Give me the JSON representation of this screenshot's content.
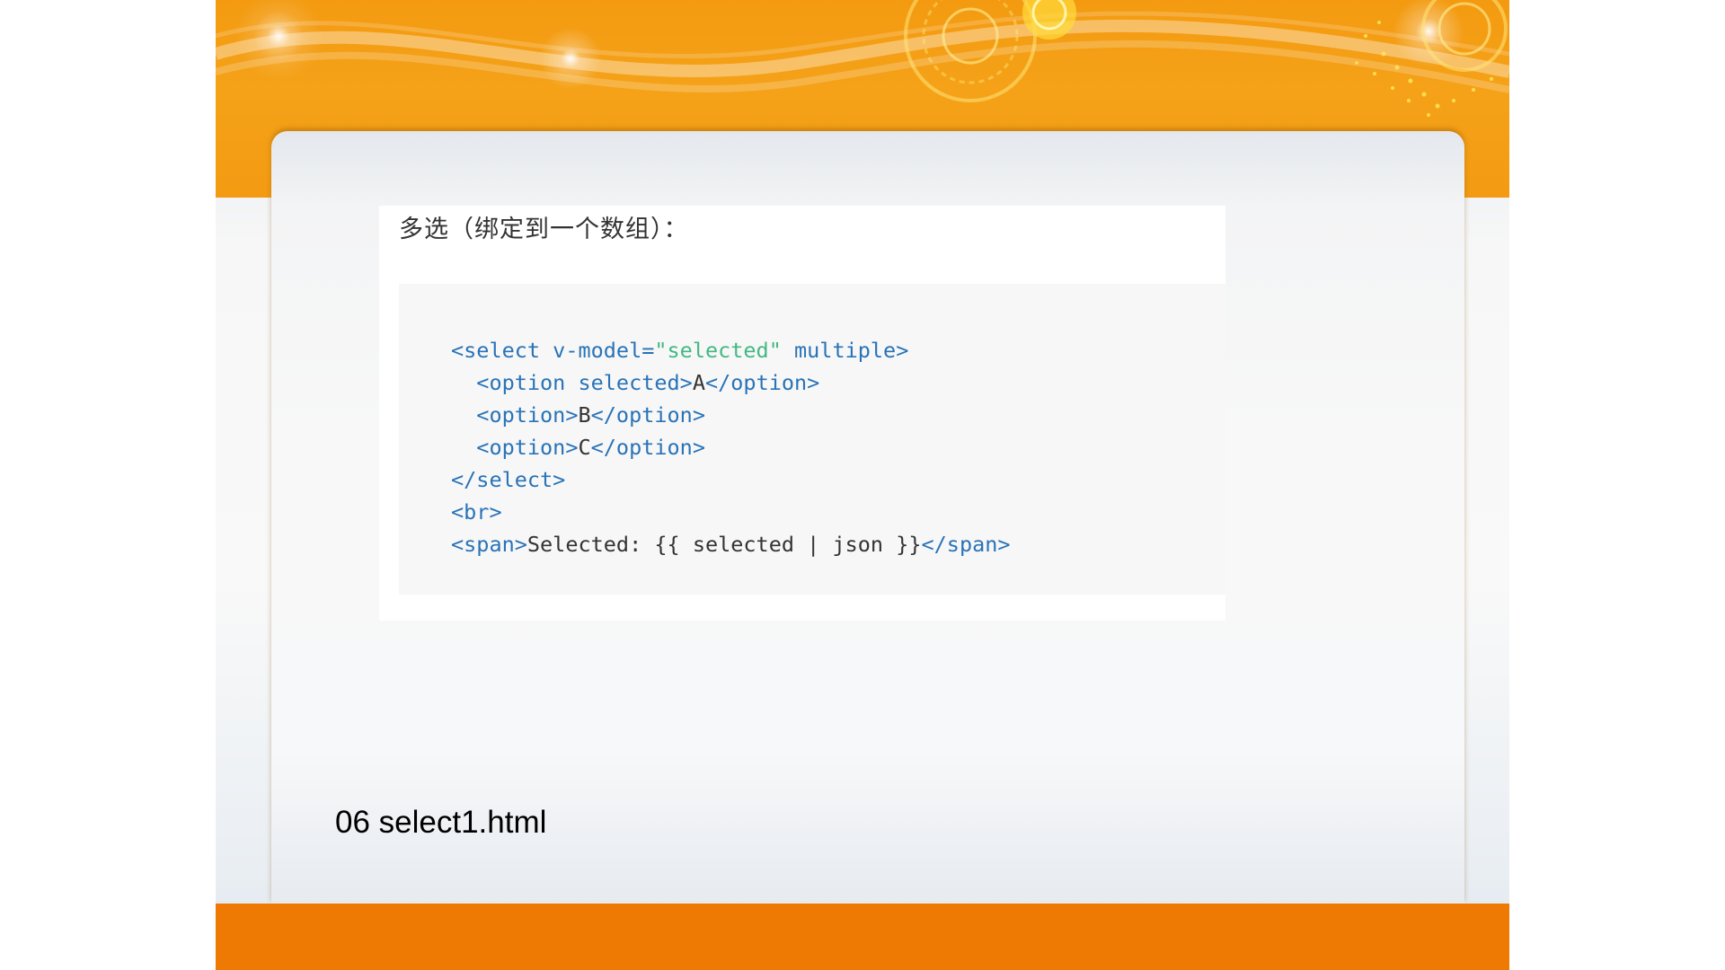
{
  "slide": {
    "heading": "多选（绑定到一个数组）：",
    "filename": "06 select1.html"
  },
  "code": {
    "line1": {
      "open": "<select v-model=",
      "value": "\"selected\"",
      "close": " multiple>"
    },
    "line2": {
      "open": "<option selected>",
      "text": "A",
      "close": "</option>"
    },
    "line3": {
      "open": "<option>",
      "text": "B",
      "close": "</option>"
    },
    "line4": {
      "open": "<option>",
      "text": "C",
      "close": "</option>"
    },
    "line5": {
      "tag": "</select>"
    },
    "line6": {
      "tag": "<br>"
    },
    "line7": {
      "open": "<span>",
      "text": "Selected: {{ selected | json }}",
      "close": "</span>"
    }
  },
  "colors": {
    "banner": "#f5a219",
    "footer": "#ee7a04",
    "tag": "#2973b7",
    "string": "#42b983"
  }
}
